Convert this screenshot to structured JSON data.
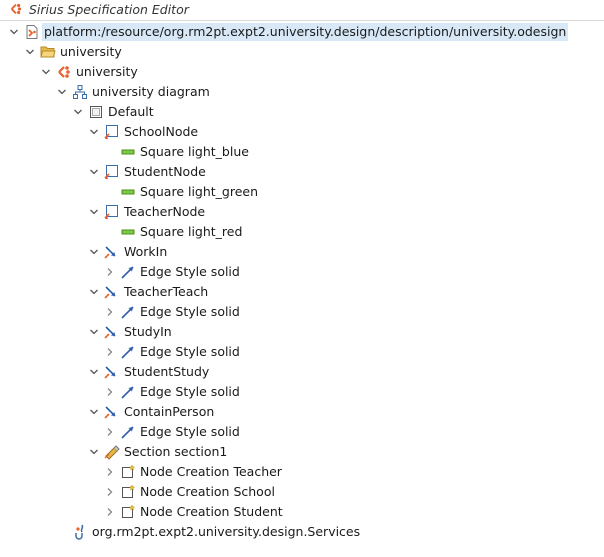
{
  "window": {
    "title": "Sirius Specification Editor"
  },
  "tree": {
    "root": "platform:/resource/org.rm2pt.expt2.university.design/description/university.odesign",
    "group": "university",
    "viewpoint": "university",
    "diagram": "university diagram",
    "layer": "Default",
    "school_node": "SchoolNode",
    "school_style": "Square light_blue",
    "student_node": "StudentNode",
    "student_style": "Square light_green",
    "teacher_node": "TeacherNode",
    "teacher_style": "Square light_red",
    "work_in": "WorkIn",
    "work_in_style": "Edge Style solid",
    "teacher_teach": "TeacherTeach",
    "teacher_teach_style": "Edge Style solid",
    "study_in": "StudyIn",
    "study_in_style": "Edge Style solid",
    "student_study": "StudentStudy",
    "student_study_style": "Edge Style solid",
    "contain_person": "ContainPerson",
    "contain_person_style": "Edge Style solid",
    "section": "Section section1",
    "tool_teacher": "Node Creation Teacher",
    "tool_school": "Node Creation School",
    "tool_student": "Node Creation Student",
    "services": "org.rm2pt.expt2.university.design.Services"
  },
  "colors": {
    "selection": "#d8e8f7",
    "sirius_orange": "#e8602c",
    "square_style_green": "#7ac943",
    "edge_blue": "#2a5caa"
  }
}
